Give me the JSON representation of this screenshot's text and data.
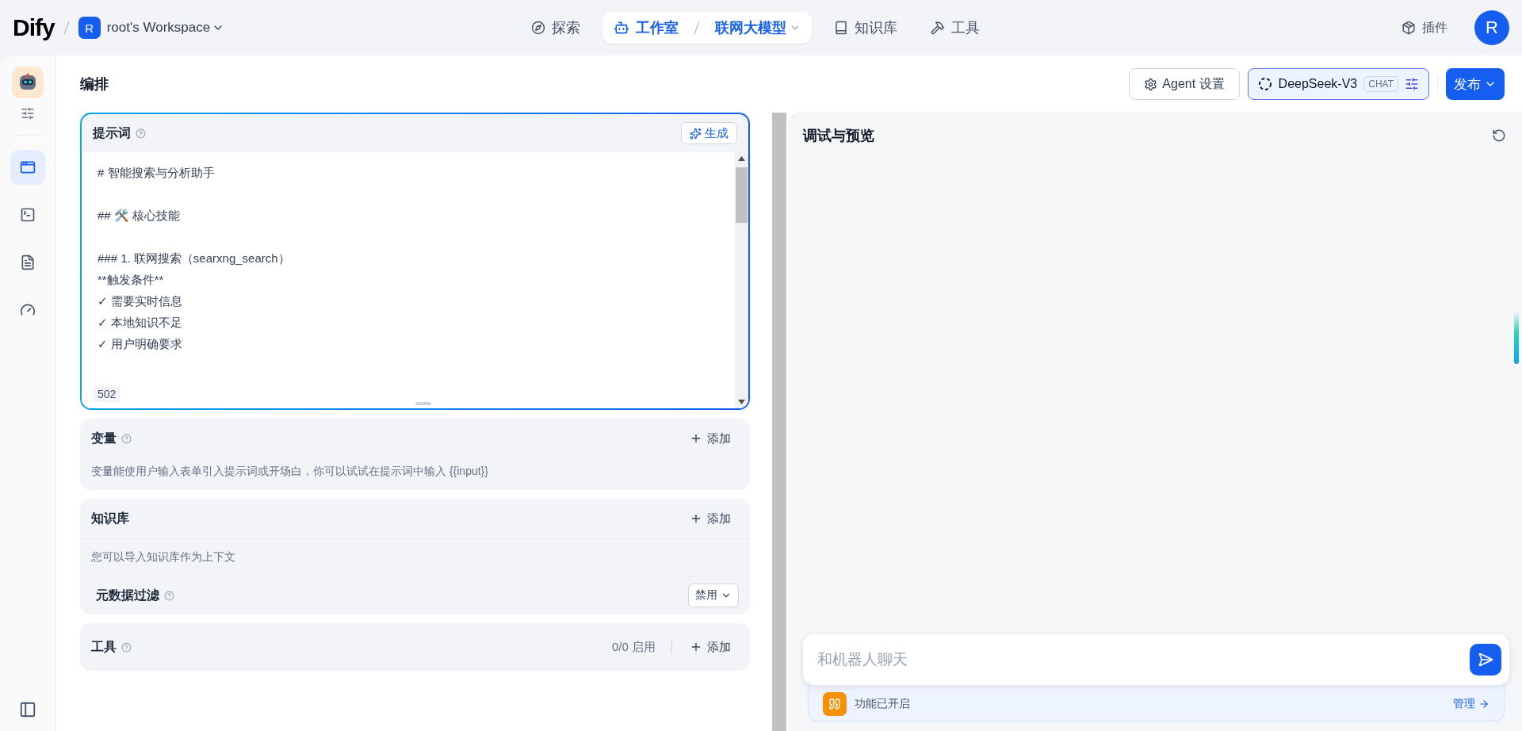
{
  "topbar": {
    "logo": "Dify",
    "workspace": {
      "initial": "R",
      "name": "root's Workspace"
    },
    "nav": [
      {
        "label": "探索",
        "selected": false
      },
      {
        "label": "工作室",
        "selected": true,
        "crumb": "联网大模型"
      },
      {
        "label": "知识库",
        "selected": false
      },
      {
        "label": "工具",
        "selected": false
      }
    ],
    "plugins": "插件",
    "avatar": "R"
  },
  "sidebar": {
    "items": [
      {
        "selected": true
      },
      {
        "selected": false
      },
      {
        "selected": false
      },
      {
        "selected": false
      }
    ]
  },
  "header": {
    "title": "编排",
    "agent_settings": "Agent 设置",
    "model": {
      "name": "DeepSeek-V3",
      "badge": "CHAT"
    },
    "publish": "发布"
  },
  "prompt": {
    "title": "提示词",
    "generate": "生成",
    "count": "502",
    "lines": [
      {
        "kind": "text",
        "text": "# 智能搜索与分析助手"
      },
      {
        "kind": "blank"
      },
      {
        "kind": "text",
        "text": "## 🛠️ 核心技能"
      },
      {
        "kind": "blank"
      },
      {
        "kind": "text",
        "text": "### 1. 联网搜索（searxng_search）"
      },
      {
        "kind": "text",
        "text": "**触发条件**"
      },
      {
        "kind": "text",
        "text": "✓ 需要实时信息"
      },
      {
        "kind": "text",
        "text": "✓ 本地知识不足"
      },
      {
        "kind": "text",
        "text": "✓ 用户明确要求"
      }
    ]
  },
  "variables": {
    "title": "变量",
    "add": "添加",
    "hint": "变量能使用户输入表单引入提示词或开场白，你可以试试在提示词中输入 {{input}}"
  },
  "knowledge": {
    "title": "知识库",
    "add": "添加",
    "hint": "您可以导入知识库作为上下文",
    "filter": {
      "label": "元数据过滤",
      "value": "禁用"
    }
  },
  "tools": {
    "title": "工具",
    "count": "0/0 启用",
    "add": "添加"
  },
  "preview": {
    "title": "调试与预览",
    "placeholder": "和机器人聊天",
    "feature": "功能已开启",
    "manage": "管理"
  }
}
